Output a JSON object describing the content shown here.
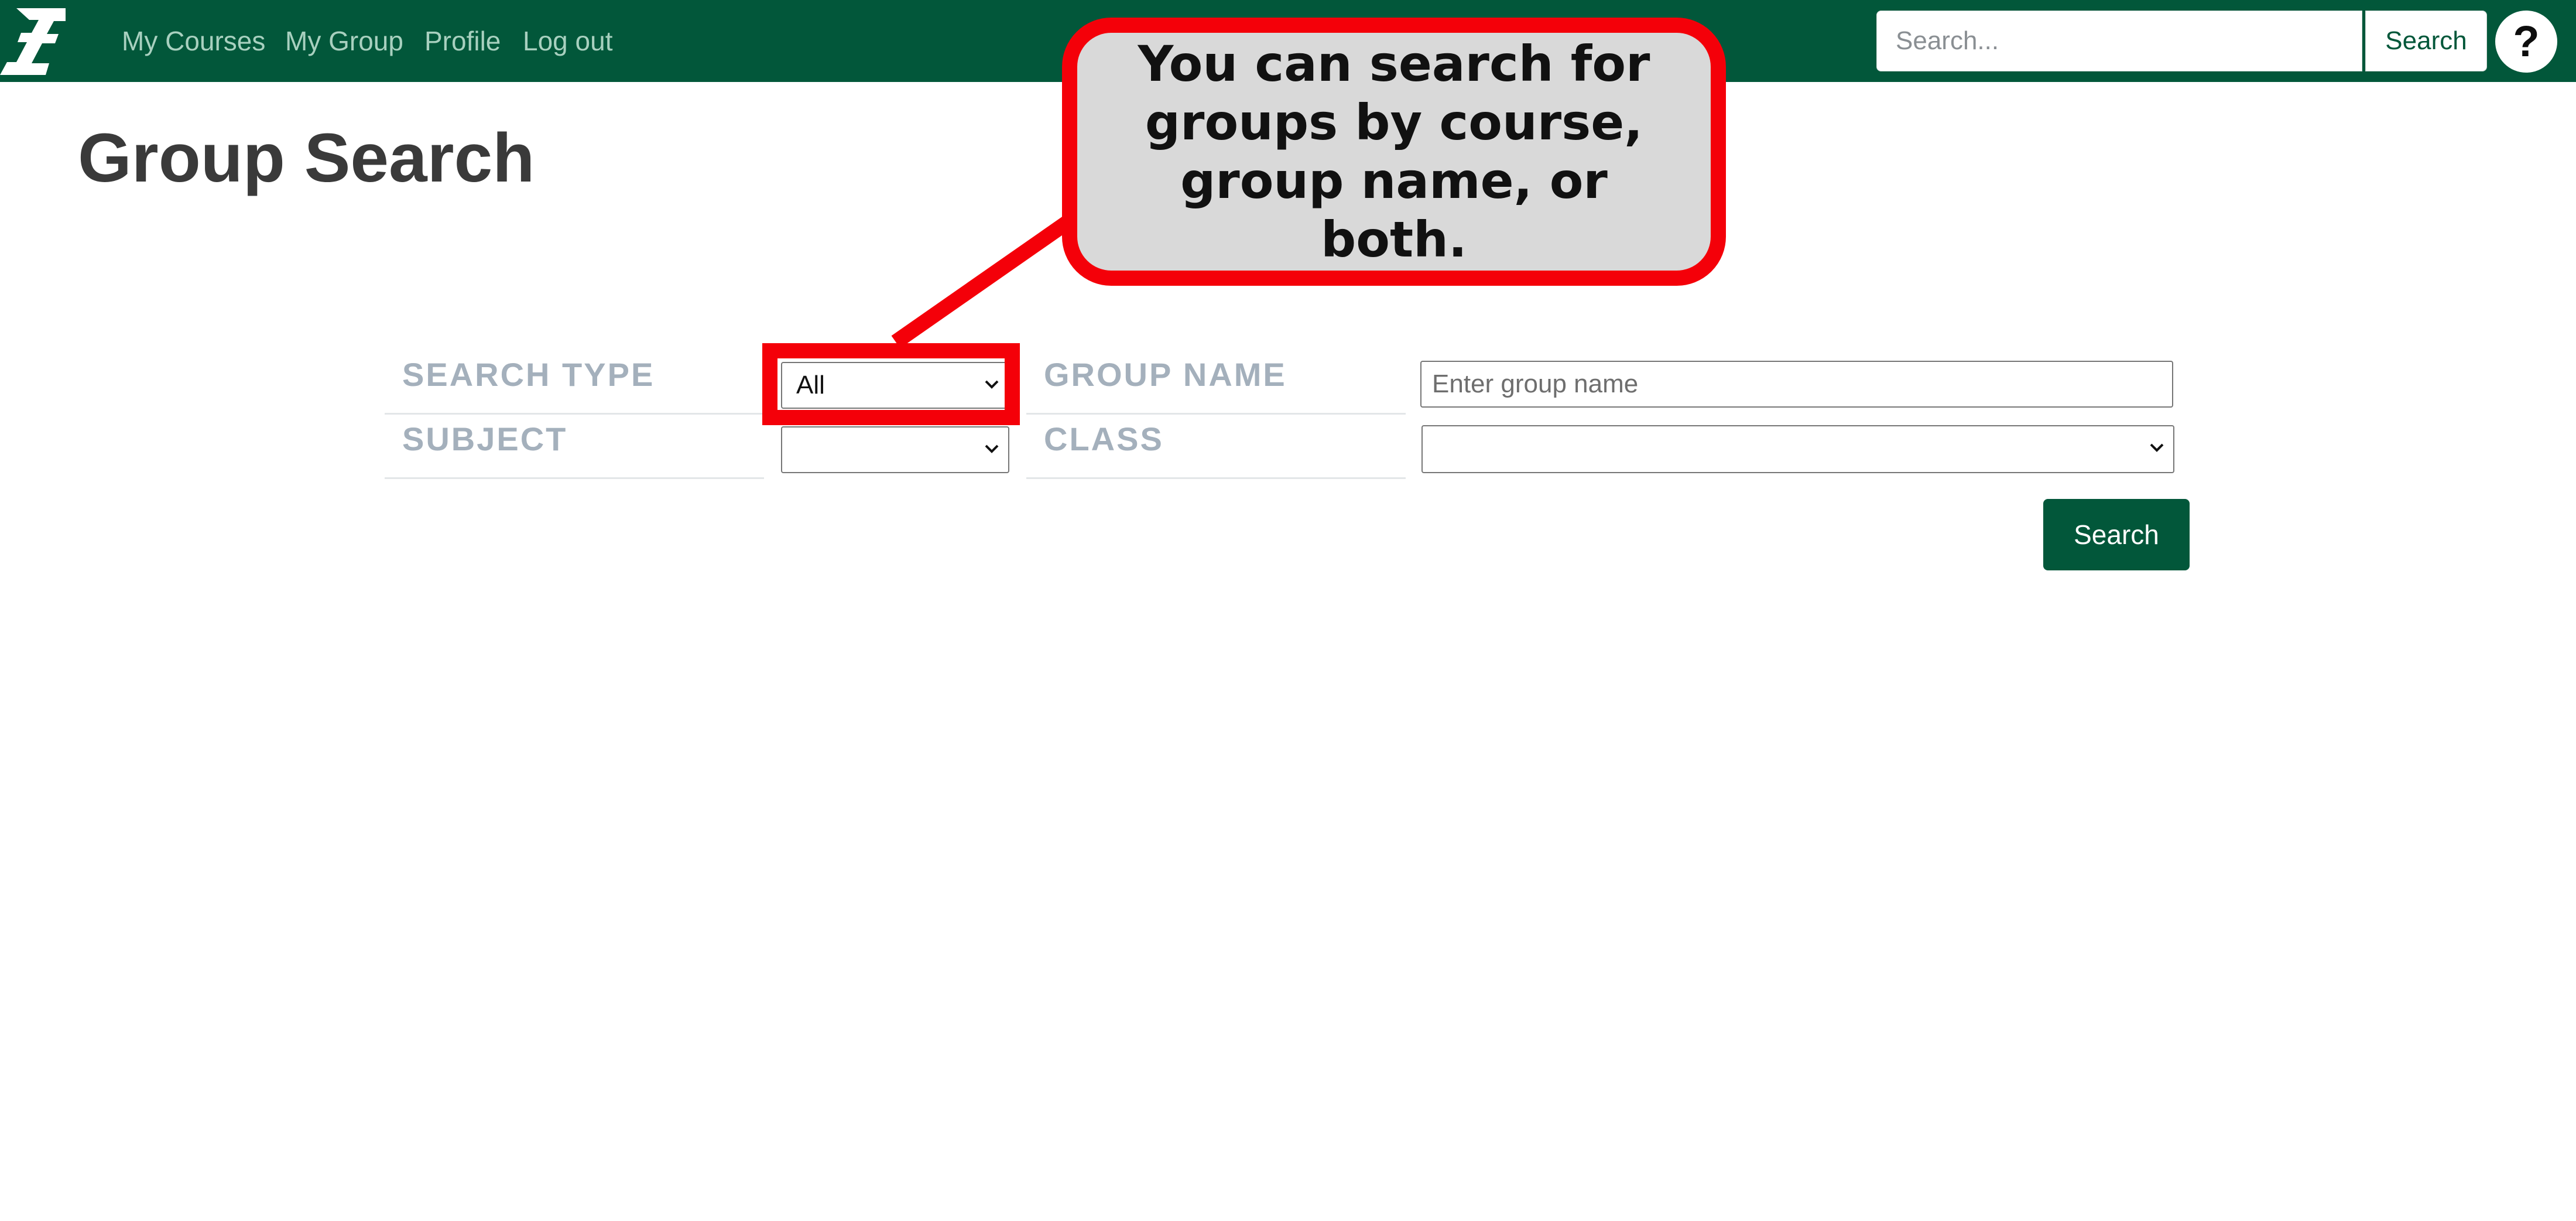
{
  "nav": {
    "links": [
      "My Courses",
      "My Group",
      "Profile",
      "Log out"
    ],
    "search_placeholder": "Search...",
    "search_button": "Search",
    "help_label": "?",
    "logo_icon": "university-logo-icon"
  },
  "page": {
    "title": "Group Search"
  },
  "form": {
    "search_type_label": "SEARCH TYPE",
    "search_type_value": "All",
    "group_name_label": "GROUP NAME",
    "group_name_placeholder": "Enter group name",
    "subject_label": "SUBJECT",
    "subject_value": "",
    "class_label": "CLASS",
    "class_value": "",
    "search_button": "Search"
  },
  "annotation": {
    "callout_text": "You can search for groups by course, group name, or both.",
    "highlight_color": "#f40009"
  },
  "colors": {
    "brand_green": "#02573a",
    "label_gray": "#a4b0bc",
    "title_gray": "#3a3a3a"
  }
}
